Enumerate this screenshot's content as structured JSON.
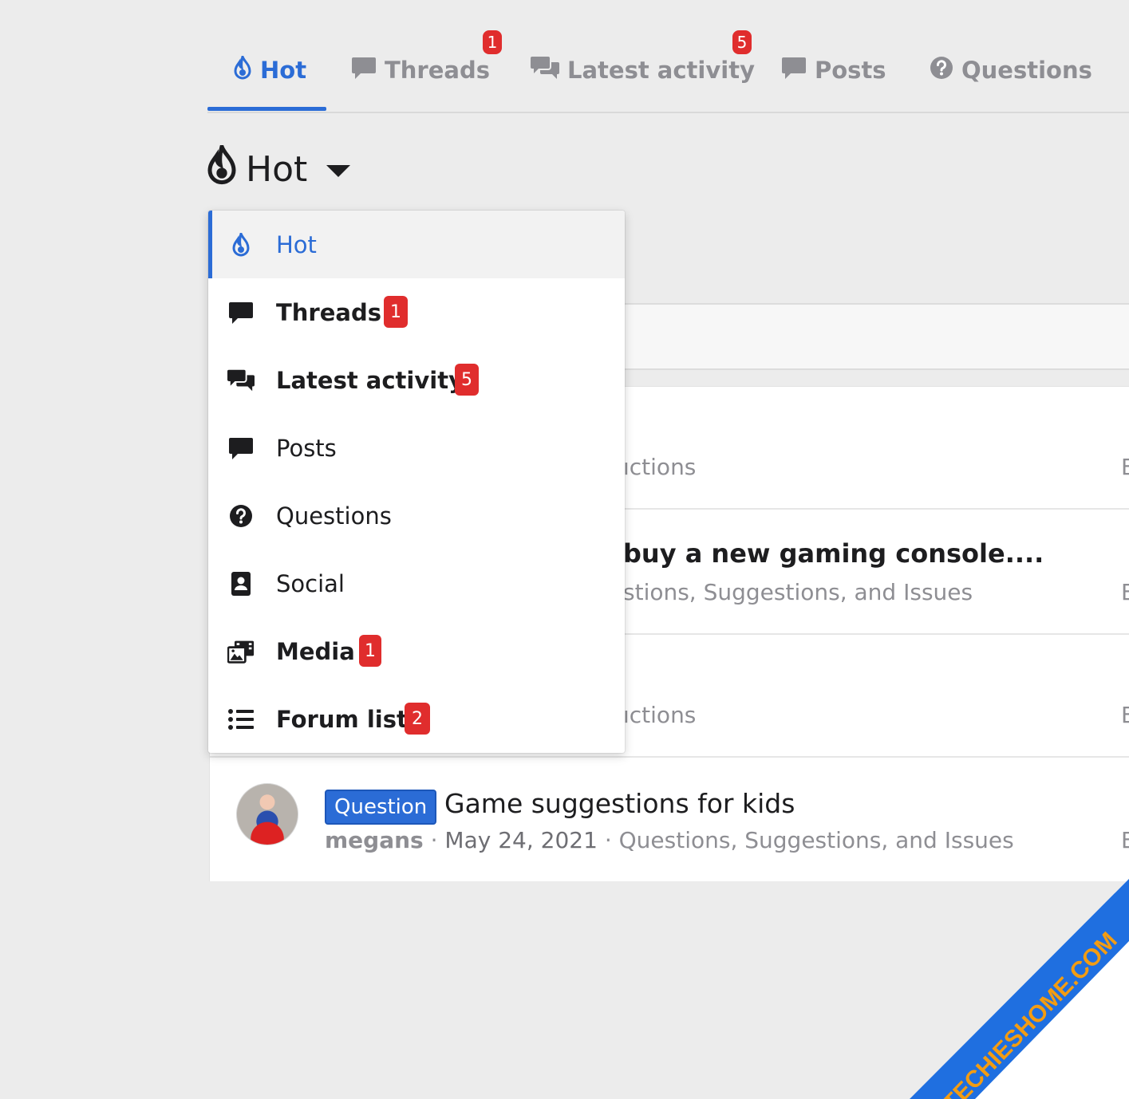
{
  "tabs": [
    {
      "label": "Hot",
      "icon": "flame-icon",
      "active": true
    },
    {
      "label": "Threads",
      "icon": "comment-icon",
      "badge": "1"
    },
    {
      "label": "Latest activity",
      "icon": "comments-icon",
      "badge": "5"
    },
    {
      "label": "Posts",
      "icon": "comment-icon"
    },
    {
      "label": "Questions",
      "icon": "question-circle-icon"
    }
  ],
  "header": {
    "title": "Hot",
    "icon": "flame-icon"
  },
  "menu": {
    "items": [
      {
        "label": "Hot",
        "icon": "flame-icon",
        "active": true
      },
      {
        "label": "Threads",
        "icon": "comment-icon",
        "badge": "1",
        "bold": true
      },
      {
        "label": "Latest activity",
        "icon": "comments-icon",
        "badge": "5",
        "bold": true
      },
      {
        "label": "Posts",
        "icon": "comment-icon"
      },
      {
        "label": "Questions",
        "icon": "question-circle-icon"
      },
      {
        "label": "Social",
        "icon": "address-card-icon"
      },
      {
        "label": "Media",
        "icon": "photo-video-icon",
        "badge": "1",
        "bold": true
      },
      {
        "label": "Forum list",
        "icon": "list-icon",
        "badge": "2",
        "bold": true
      }
    ]
  },
  "background_list": {
    "row1_meta_fragment": "ıctions",
    "row2_title_fragment": "buy a new gaming console....",
    "row2_meta_fragment": "stions, Suggestions, and Issues",
    "row3_meta_fragment": "ıctions",
    "edge_letter": "E",
    "question": {
      "prefix": "Question",
      "title": "Game suggestions for kids",
      "author": "megans",
      "date": "May 24, 2021",
      "forum": "Questions, Suggestions, and Issues",
      "sep": "·"
    }
  },
  "watermark": {
    "text": "TECHIESHOME.COM"
  },
  "colors": {
    "accent": "#2b6cd6",
    "badge": "#e02d2d",
    "muted": "#8e8e93",
    "watermark_band": "#1f6fe0",
    "watermark_text": "#f39c12"
  }
}
